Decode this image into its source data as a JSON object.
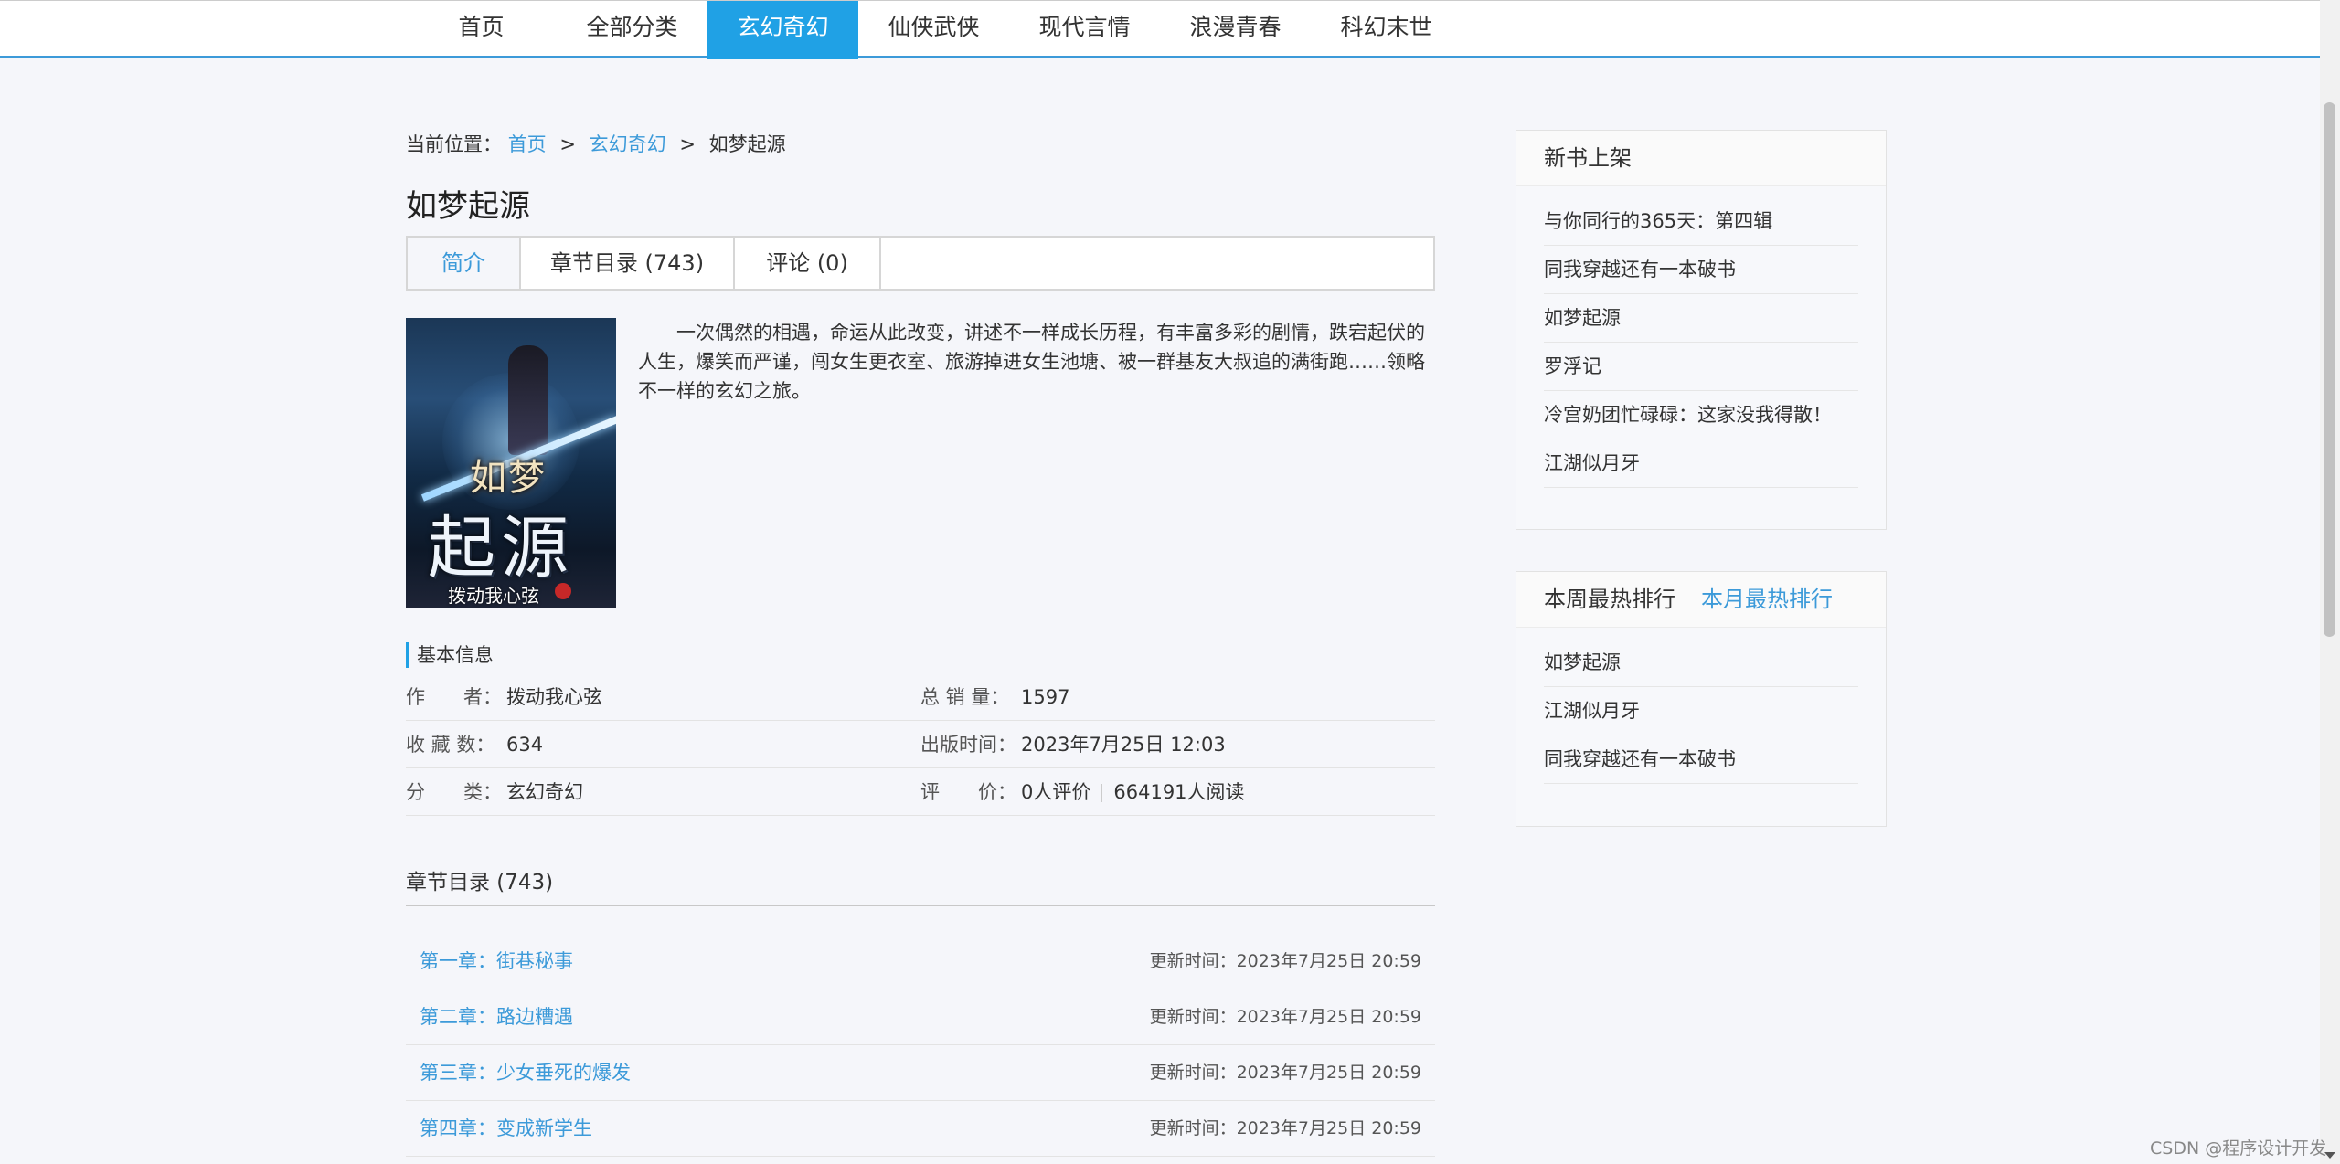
{
  "nav": {
    "items": [
      {
        "label": "首页"
      },
      {
        "label": "全部分类"
      },
      {
        "label": "玄幻奇幻"
      },
      {
        "label": "仙侠武侠"
      },
      {
        "label": "现代言情"
      },
      {
        "label": "浪漫青春"
      },
      {
        "label": "科幻末世"
      }
    ],
    "active_index": 2
  },
  "breadcrumb": {
    "prefix": "当前位置：",
    "home": "首页",
    "category": "玄幻奇幻",
    "current": "如梦起源",
    "separator": ">"
  },
  "book": {
    "title": "如梦起源",
    "cover": {
      "title_top": "如梦",
      "title_main": "起源",
      "author": "拨动我心弦"
    },
    "intro": "一次偶然的相遇，命运从此改变，讲述不一样成长历程，有丰富多彩的剧情，跌宕起伏的人生，爆笑而严谨，闯女生更衣室、旅游掉进女生池塘、被一群基友大叔追的满街跑……领略不一样的玄幻之旅。"
  },
  "tabs": {
    "intro": "简介",
    "chapters": "章节目录 (743)",
    "comments": "评论 (0)"
  },
  "basic_info": {
    "label": "基本信息",
    "author_key": "作　　者：",
    "author_val": "拨动我心弦",
    "sales_key": "总 销 量：",
    "sales_val": "1597",
    "fav_key": "收 藏 数：",
    "fav_val": "634",
    "publish_key": "出版时间：",
    "publish_val": "2023年7月25日 12:03",
    "category_key": "分　　类：",
    "category_val": "玄幻奇幻",
    "rating_key": "评　　价：",
    "rating_val": "0人评价",
    "reads_val": "664191人阅读"
  },
  "chapters": {
    "heading": "章节目录 (743)",
    "items": [
      {
        "name": "第一章：街巷秘事",
        "time": "更新时间：2023年7月25日 20:59"
      },
      {
        "name": "第二章：路边糟遇",
        "time": "更新时间：2023年7月25日 20:59"
      },
      {
        "name": "第三章：少女垂死的爆发",
        "time": "更新时间：2023年7月25日 20:59"
      },
      {
        "name": "第四章：变成新学生",
        "time": "更新时间：2023年7月25日 20:59"
      }
    ]
  },
  "new_books": {
    "title": "新书上架",
    "items": [
      "与你同行的365天：第四辑",
      "同我穿越还有一本破书",
      "如梦起源",
      "罗浮记",
      "冷宫奶团忙碌碌：这家没我得散！",
      "江湖似月牙"
    ]
  },
  "hot_rank": {
    "tab_week": "本周最热排行",
    "tab_month": "本月最热排行",
    "items": [
      "如梦起源",
      "江湖似月牙",
      "同我穿越还有一本破书"
    ]
  },
  "watermark": "CSDN @程序设计开发",
  "colors": {
    "accent": "#20a1e5",
    "link": "#3c9ad9",
    "background": "#f5f6fa"
  }
}
